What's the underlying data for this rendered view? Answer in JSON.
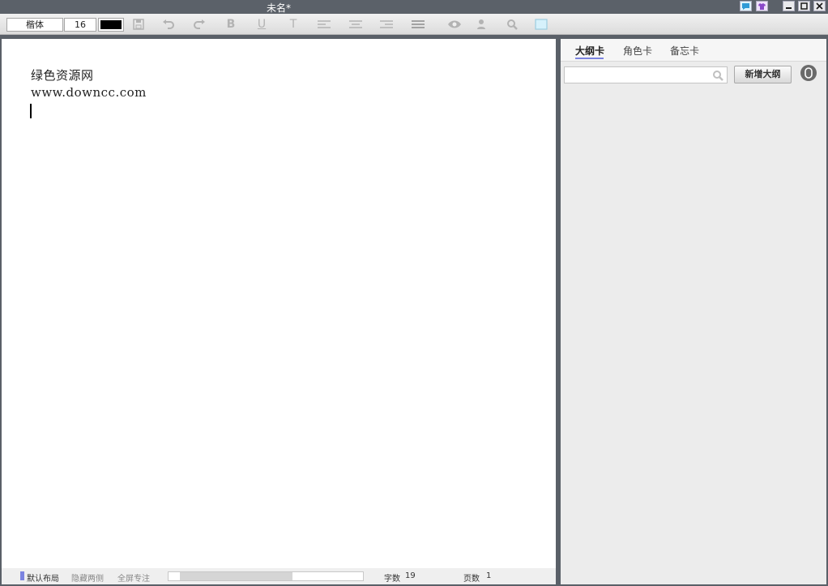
{
  "window": {
    "title": "未名*",
    "controls": [
      "minimize",
      "maximize",
      "close"
    ]
  },
  "toolbar": {
    "font": "楷体",
    "size": "16",
    "text_color": "#000000",
    "icons": [
      "save-icon",
      "undo-icon",
      "redo-icon",
      "bold-icon",
      "underline-icon",
      "text-style-icon",
      "align-left-icon",
      "align-center-icon",
      "align-right-icon",
      "justify-icon",
      "preview-icon",
      "user-icon",
      "search-icon",
      "frame-icon"
    ]
  },
  "editor": {
    "lines": [
      "绿色资源网",
      "www.downcc.com"
    ]
  },
  "statusbar": {
    "layout_default": "默认布局",
    "hide_sides": "隐藏两侧",
    "fullscreen_focus": "全屏专注",
    "word_count_label": "字数",
    "word_count": "19",
    "page_label": "页数",
    "page_count": "1"
  },
  "sidebar": {
    "tabs": [
      "大纲卡",
      "角色卡",
      "备忘卡"
    ],
    "active_tab": "大纲卡",
    "search_value": "",
    "add_button": "新增大纲"
  },
  "colors": {
    "frame": "#5b6169",
    "accent": "#7b83e0",
    "sidebar_bg": "#ececec"
  }
}
